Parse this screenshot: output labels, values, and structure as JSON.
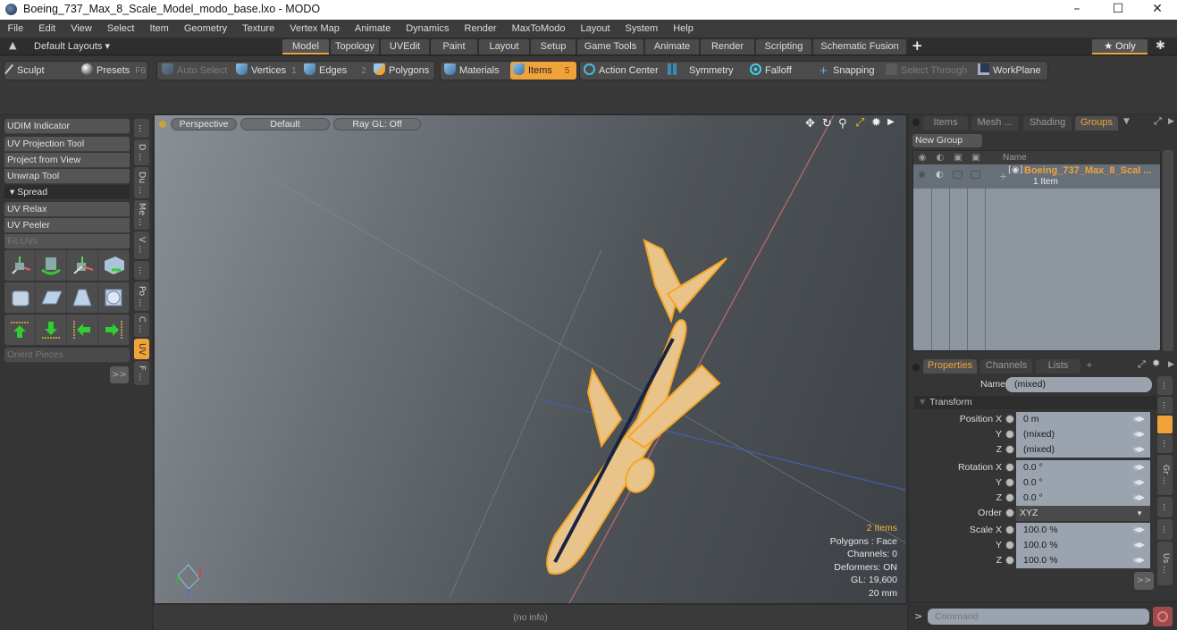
{
  "window": {
    "title": "Boeing_737_Max_8_Scale_Model_modo_base.lxo - MODO",
    "minimize_icon": "minimize-icon",
    "maximize_icon": "maximize-icon",
    "close_icon": "close-icon",
    "min": "–",
    "max": "☐",
    "close": "✕"
  },
  "menubar": [
    "File",
    "Edit",
    "View",
    "Select",
    "Item",
    "Geometry",
    "Texture",
    "Vertex Map",
    "Animate",
    "Dynamics",
    "Render",
    "MaxToModo",
    "Layout",
    "System",
    "Help"
  ],
  "layoutbar": {
    "layouts_label": "Default Layouts ▾",
    "tabs": [
      "Model",
      "Topology",
      "UVEdit",
      "Paint",
      "Layout",
      "Setup",
      "Game Tools",
      "Animate",
      "Render",
      "Scripting",
      "Schematic Fusion"
    ],
    "active_tab": "Model",
    "add_label": "+",
    "only_label": "★ Only",
    "gear": "✱"
  },
  "toolbar": {
    "sculpt": "Sculpt",
    "presets": "Presets",
    "presets_key": "F6",
    "auto_select": "Auto Select",
    "vertices": "Vertices",
    "vertices_num": "1",
    "edges": "Edges",
    "edges_num": "2",
    "polygons": "Polygons",
    "materials": "Materials",
    "items": "Items",
    "items_num": "5",
    "action_center": "Action Center",
    "symmetry": "Symmetry",
    "falloff": "Falloff",
    "snapping": "Snapping",
    "select_through": "Select Through",
    "workplane": "WorkPlane"
  },
  "leftpanel": {
    "buttons": [
      "UDIM Indicator",
      "UV Projection Tool",
      "Project from View",
      "Unwrap Tool"
    ],
    "spread_header": "▾ Spread",
    "buttons2": [
      "UV Relax",
      "UV Peeler",
      "Fit UVs"
    ],
    "orient_pieces": "Orient Pieces",
    "more": ">>",
    "vtabs": [
      "...",
      "D ...",
      "Du ...",
      "Me ...",
      "V ...",
      "...",
      "Po ...",
      "C ...",
      "UV",
      "F ..."
    ],
    "active_vtab": "UV"
  },
  "viewport": {
    "view_mode": "Perspective",
    "shading": "Default",
    "raygl": "Ray GL: Off",
    "stats": {
      "items": "2 Items",
      "polygons": "Polygons : Face",
      "channels": "Channels: 0",
      "deformers": "Deformers: ON",
      "gl": "GL: 19,600",
      "scale": "20 mm"
    },
    "info": "(no info)"
  },
  "groups_panel": {
    "tabs": [
      "Items",
      "Mesh ...",
      "Shading",
      "Groups"
    ],
    "active_tab": "Groups",
    "new_group": "New Group",
    "name_col": "Name",
    "group_name": "Boeing_737_Max_8_Scal ...",
    "group_count": "1 Item"
  },
  "properties_panel": {
    "tabs": [
      "Properties",
      "Channels",
      "Lists",
      "+"
    ],
    "active_tab": "Properties",
    "name_label": "Name",
    "name_value": "(mixed)",
    "transform_header": "Transform",
    "rows": [
      {
        "label": "Position X",
        "value": "0 m"
      },
      {
        "label": "Y",
        "value": "(mixed)"
      },
      {
        "label": "Z",
        "value": "(mixed)"
      },
      {
        "label": "Rotation X",
        "value": "0.0 °"
      },
      {
        "label": "Y",
        "value": "0.0 °"
      },
      {
        "label": "Z",
        "value": "0.0 °"
      },
      {
        "label": "Order",
        "value": "XYZ"
      },
      {
        "label": "Scale X",
        "value": "100.0 %"
      },
      {
        "label": "Y",
        "value": "100.0 %"
      },
      {
        "label": "Z",
        "value": "100.0 %"
      }
    ],
    "more": ">>",
    "vtabs": [
      "...",
      "...",
      "...",
      "Gr ...",
      "...",
      "...",
      "Us ..."
    ]
  },
  "command": {
    "prompt": ">",
    "placeholder": "Command"
  },
  "colors": {
    "accent": "#f0a33a",
    "selection_wire": "#f5a623"
  }
}
